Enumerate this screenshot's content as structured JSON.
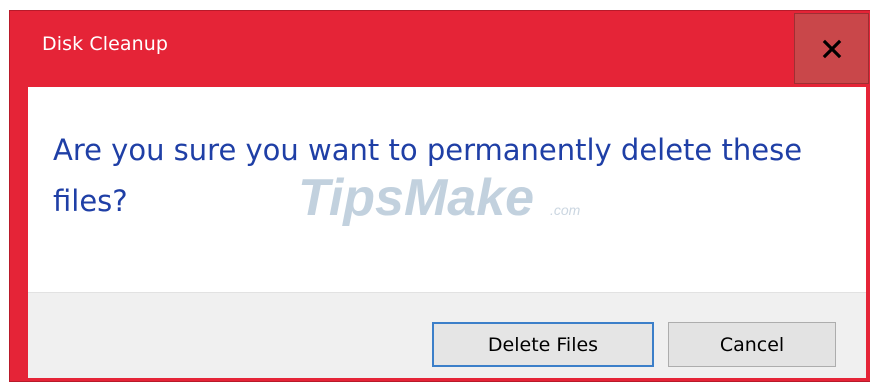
{
  "dialog": {
    "title": "Disk Cleanup",
    "close_icon": "close-icon",
    "message": "Are you sure you want to permanently delete these files?",
    "buttons": {
      "primary_label": "Delete Files",
      "cancel_label": "Cancel"
    }
  },
  "watermark": {
    "text_main": "TipsMake",
    "text_suffix": ".com"
  },
  "colors": {
    "titlebar": "#e52437",
    "close_button": "#c9474a",
    "message_text": "#1f3fa6",
    "footer": "#f0f0f0",
    "primary_button_border": "#3c7fc9"
  }
}
